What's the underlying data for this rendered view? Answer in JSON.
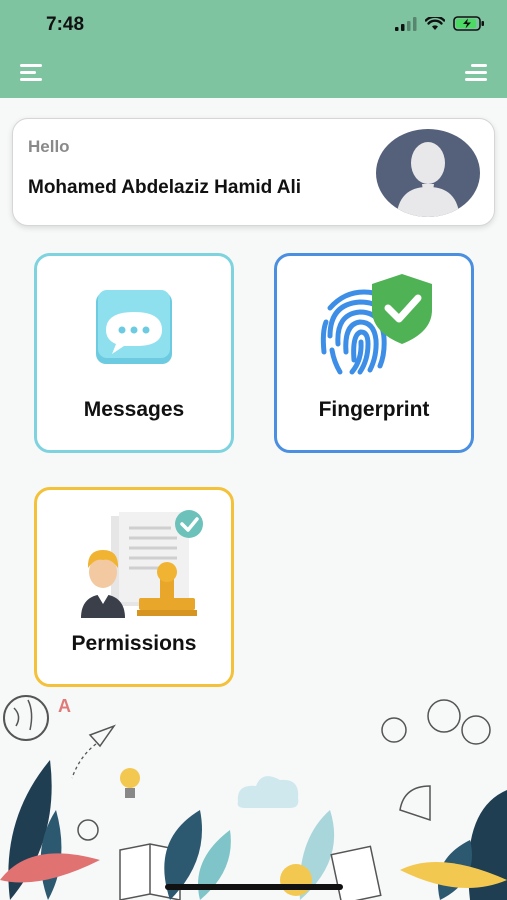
{
  "status_bar": {
    "time": "7:48"
  },
  "header": {
    "left_menu_icon": "hamburger-icon",
    "right_menu_icon": "menu-lines-icon"
  },
  "user_card": {
    "greeting": "Hello",
    "name": "Mohamed Abdelaziz Hamid Ali",
    "avatar_icon": "user-silhouette-icon"
  },
  "tiles": [
    {
      "label": "Messages",
      "icon": "chat-bubble-icon",
      "border_color": "#7ed3df"
    },
    {
      "label": "Fingerprint",
      "icon": "fingerprint-shield-icon",
      "border_color": "#4a8fe0"
    },
    {
      "label": "Permissions",
      "icon": "document-stamp-icon",
      "border_color": "#f3c13a"
    }
  ],
  "colors": {
    "header": "#7fc4a0",
    "background": "#f7f8f8",
    "avatar_bg": "#55607a"
  }
}
